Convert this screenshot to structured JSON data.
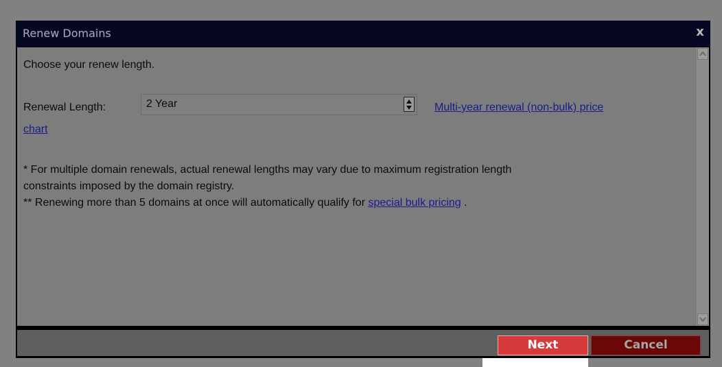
{
  "dialog": {
    "title": "Renew Domains",
    "close_label": "x"
  },
  "content": {
    "intro": "Choose your renew length.",
    "renewal_label": "Renewal Length:",
    "renewal_value": "2 Year",
    "price_link_part1": "Multi-year renewal (non-bulk) price",
    "price_link_part2": "chart",
    "note1_line1": "* For multiple domain renewals, actual renewal lengths may vary due to maximum registration length",
    "note1_line2": "constraints imposed by the domain registry.",
    "note2_prefix": "** Renewing more than 5 domains at once will automatically qualify for",
    "note2_link": "special bulk pricing",
    "note2_suffix": "."
  },
  "footer": {
    "next_label": "Next",
    "cancel_label": "Cancel"
  },
  "colors": {
    "title_bar": "#060822",
    "content_bg": "#7d7d7d",
    "link": "#1a1b8c",
    "next_button": "#d63b3b",
    "cancel_button": "#6a0808"
  },
  "icons": [
    "close-icon",
    "select-arrows-icon",
    "scroll-up-icon",
    "scroll-down-icon"
  ]
}
